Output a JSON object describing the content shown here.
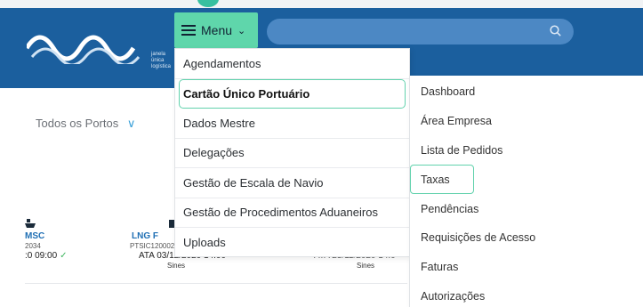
{
  "header": {
    "logo_text": "janela\núnica\nlogística",
    "menu_label": "Menu",
    "search_placeholder": ""
  },
  "filters": {
    "ports_label": "Todos os Portos"
  },
  "vessels": {
    "first_name": "MSC",
    "first_code": "2034",
    "first_time": ":0 09:00",
    "second_name": "LNG F",
    "second_code": "PTSIC120002",
    "second_ata": "ATA 03/12/2020 14:00",
    "second_port": "Sines",
    "third_ata": "ATA 23/11/2020 14:0",
    "third_port": "Sines"
  },
  "menu": {
    "items": [
      {
        "label": "Agendamentos"
      },
      {
        "label": "Cartão Único Portuário"
      },
      {
        "label": "Dados Mestre"
      },
      {
        "label": "Delegações"
      },
      {
        "label": "Gestão de Escala de Navio"
      },
      {
        "label": "Gestão de Procedimentos Aduaneiros"
      },
      {
        "label": "Uploads"
      }
    ],
    "active_index": 1
  },
  "submenu": {
    "items": [
      {
        "label": "Dashboard"
      },
      {
        "label": "Área Empresa"
      },
      {
        "label": "Lista de Pedidos"
      },
      {
        "label": "Taxas"
      },
      {
        "label": "Pendências"
      },
      {
        "label": "Requisições de Acesso"
      },
      {
        "label": "Faturas"
      },
      {
        "label": "Autorizações"
      }
    ],
    "active_index": 3
  },
  "colors": {
    "header_blue": "#1b5f9e",
    "accent_green": "#5fd6ab"
  }
}
